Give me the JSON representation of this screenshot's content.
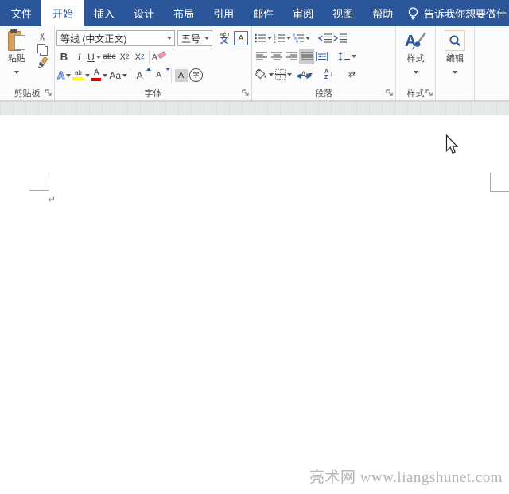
{
  "colors": {
    "titlebar_blue": "#2b579a",
    "icon_blue": "#2f5b9d",
    "highlight_yellow": "#ffff00",
    "font_color_red": "#e00000",
    "watermark_gray": "#b4b4b4"
  },
  "tabbar": {
    "tabs": [
      {
        "label": "文件",
        "active": false
      },
      {
        "label": "开始",
        "active": true
      },
      {
        "label": "插入",
        "active": false
      },
      {
        "label": "设计",
        "active": false
      },
      {
        "label": "布局",
        "active": false
      },
      {
        "label": "引用",
        "active": false
      },
      {
        "label": "邮件",
        "active": false
      },
      {
        "label": "审阅",
        "active": false
      },
      {
        "label": "视图",
        "active": false
      },
      {
        "label": "帮助",
        "active": false
      }
    ],
    "tell_me": "告诉我你想要做什"
  },
  "ribbon": {
    "clipboard": {
      "paste_label": "粘贴",
      "footer": "剪贴板",
      "cut_glyph": "✂"
    },
    "font": {
      "footer": "字体",
      "font_name": "等线 (中文正文)",
      "font_size": "五号",
      "phonetic_top": "wén",
      "phonetic_bottom": "文",
      "char_border": "A",
      "bold": "B",
      "italic": "I",
      "underline": "U",
      "strikethrough": "abc",
      "subscript_base": "X",
      "subscript_n": "2",
      "superscript_base": "X",
      "superscript_n": "2",
      "clear_format": "A",
      "text_effects": "A",
      "highlight": "ab",
      "font_color": "A",
      "change_case": "Aa",
      "grow_font": "A",
      "shrink_font": "A",
      "char_shading": "A",
      "enclose_char": "字"
    },
    "paragraph": {
      "footer": "段落",
      "asian_layout": "A",
      "sort_a": "A",
      "sort_z": "Z",
      "sort_arrow": "↓",
      "marks_glyph": "⇄"
    },
    "styles": {
      "button_label": "样式",
      "big_letter": "A",
      "footer": "样式"
    },
    "editing": {
      "button_label": "编辑"
    }
  },
  "document": {
    "paragraph_mark": "↵"
  },
  "watermark": "亮术网 www.liangshunet.com"
}
